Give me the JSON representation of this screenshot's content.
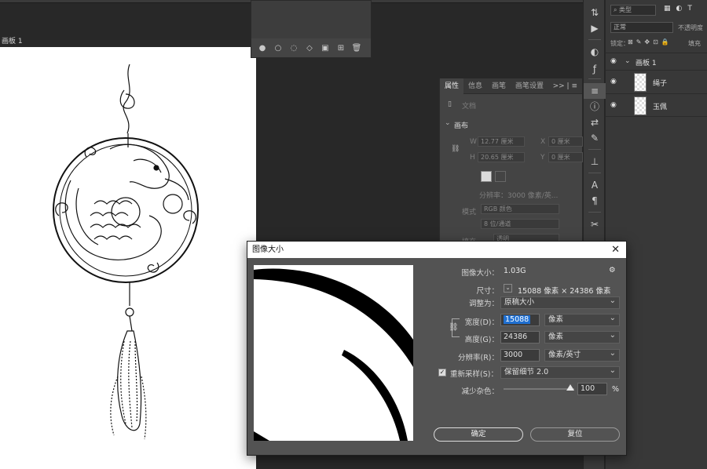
{
  "workspace": {
    "artboard_label": "画板 1"
  },
  "properties": {
    "tabs": [
      "属性",
      "信息",
      "画笔",
      "画笔设置"
    ],
    "tab_extra": ">> | ≡",
    "doc_label": "文档",
    "section": "画布",
    "w_label": "W",
    "w_value": "12.77 厘米",
    "x_label": "X",
    "x_value": "0 厘米",
    "h_label": "H",
    "h_value": "20.65 厘米",
    "y_label": "Y",
    "y_value": "0 厘米",
    "resolution": "分辨率：3000 像素/英...",
    "mode_label": "模式",
    "mode_value": "RGB 颜色",
    "depth_value": "8 位/通道",
    "fill_label": "填充",
    "fill_value": "透明"
  },
  "layers": {
    "search_placeholder": "类型",
    "blend_mode": "正常",
    "opacity_label": "不透明度",
    "lock_label": "锁定：",
    "fill_label": "填充",
    "group_name": "画板 1",
    "items": [
      {
        "name": "绳子"
      },
      {
        "name": "玉佩"
      }
    ]
  },
  "dialog": {
    "title": "图像大小",
    "image_size_label": "图像大小：",
    "image_size_value": "1.03G",
    "dimensions_label": "尺寸：",
    "dimensions_value": "15088 像素 × 24386 像素",
    "fit_label": "调整为：",
    "fit_value": "原稿大小",
    "width_label": "宽度(D)：",
    "width_value": "15088",
    "width_unit": "像素",
    "height_label": "高度(G)：",
    "height_value": "24386",
    "height_unit": "像素",
    "resolution_label": "分辨率(R)：",
    "resolution_value": "3000",
    "resolution_unit": "像素/英寸",
    "resample_label": "重新采样(S)：",
    "resample_checked": true,
    "resample_value": "保留细节 2.0",
    "noise_label": "减少杂色：",
    "noise_value": "100",
    "noise_unit": "%",
    "noise_level": 1.0,
    "ok_label": "确定",
    "reset_label": "复位"
  }
}
